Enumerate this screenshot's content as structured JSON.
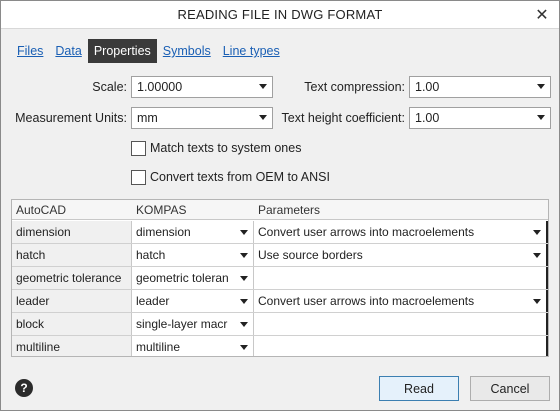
{
  "window": {
    "title": "READING FILE IN DWG FORMAT",
    "close_glyph": "✕"
  },
  "tabs": [
    {
      "label": "Files",
      "active": false
    },
    {
      "label": "Data",
      "active": false
    },
    {
      "label": "Properties",
      "active": true
    },
    {
      "label": "Symbols",
      "active": false
    },
    {
      "label": "Line types",
      "active": false
    }
  ],
  "settings": {
    "scale": {
      "label": "Scale:",
      "value": "1.00000"
    },
    "text_compression": {
      "label": "Text compression:",
      "value": "1.00"
    },
    "measurement_units": {
      "label": "Measurement Units:",
      "value": "mm"
    },
    "text_height_coefficient": {
      "label": "Text height coefficient:",
      "value": "1.00"
    }
  },
  "checkboxes": {
    "match_texts": {
      "label": "Match texts to system ones",
      "checked": false
    },
    "convert_oem": {
      "label": "Convert texts from OEM to ANSI",
      "checked": false
    }
  },
  "table": {
    "headers": [
      "AutoCAD",
      "KOMPAS",
      "Parameters"
    ],
    "rows": [
      {
        "autocad": "dimension",
        "kompas": "dimension",
        "parameters": "Convert user arrows into macroelements",
        "has_param_dropdown": true
      },
      {
        "autocad": "hatch",
        "kompas": "hatch",
        "parameters": "Use source borders",
        "has_param_dropdown": true
      },
      {
        "autocad": "geometric tolerance",
        "kompas": "geometric toleran",
        "parameters": "",
        "has_param_dropdown": false
      },
      {
        "autocad": "leader",
        "kompas": "leader",
        "parameters": "Convert user arrows into macroelements",
        "has_param_dropdown": true
      },
      {
        "autocad": "block",
        "kompas": "single-layer macr",
        "parameters": "",
        "has_param_dropdown": false
      },
      {
        "autocad": "multiline",
        "kompas": "multiline",
        "parameters": "",
        "has_param_dropdown": false
      }
    ]
  },
  "footer": {
    "help_glyph": "?",
    "read_label": "Read",
    "cancel_label": "Cancel"
  },
  "colors": {
    "active_tab_bg": "#3a3a3a",
    "link": "#1a5fb4",
    "primary_border": "#3c7fb1"
  }
}
